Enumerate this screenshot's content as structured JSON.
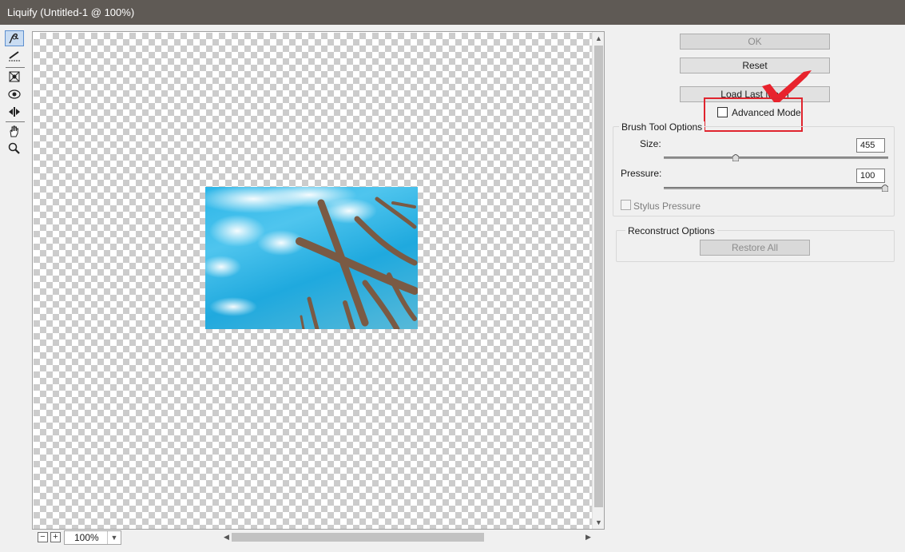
{
  "window": {
    "title": "Liquify (Untitled-1 @ 100%)"
  },
  "tools": [
    {
      "name": "forward-warp-tool-icon",
      "active": true
    },
    {
      "name": "reconstruct-tool-icon",
      "active": false
    },
    {
      "name": "pucker-tool-icon",
      "active": false
    },
    {
      "name": "bloat-tool-icon",
      "active": false
    },
    {
      "name": "push-left-tool-icon",
      "active": false
    },
    {
      "name": "hand-tool-icon",
      "active": false
    },
    {
      "name": "zoom-tool-icon",
      "active": false
    }
  ],
  "canvas": {
    "zoom_value": "100%"
  },
  "buttons": {
    "ok": "OK",
    "reset": "Reset",
    "load_last_mesh": "Load Last Mesh"
  },
  "advanced_mode": {
    "label": "Advanced Mode",
    "checked": false
  },
  "brush_options": {
    "title": "Brush Tool Options",
    "size_label": "Size:",
    "size_value": "455",
    "size_fraction": 0.32,
    "pressure_label": "Pressure:",
    "pressure_value": "100",
    "pressure_fraction": 1.0,
    "stylus_label": "Stylus Pressure"
  },
  "reconstruct": {
    "title": "Reconstruct Options",
    "restore_all": "Restore All"
  },
  "colors": {
    "titlebar": "#5f5a55",
    "highlight": "#e0242e",
    "checkmark": "#e8232d",
    "sky": "#2ab5e8"
  }
}
